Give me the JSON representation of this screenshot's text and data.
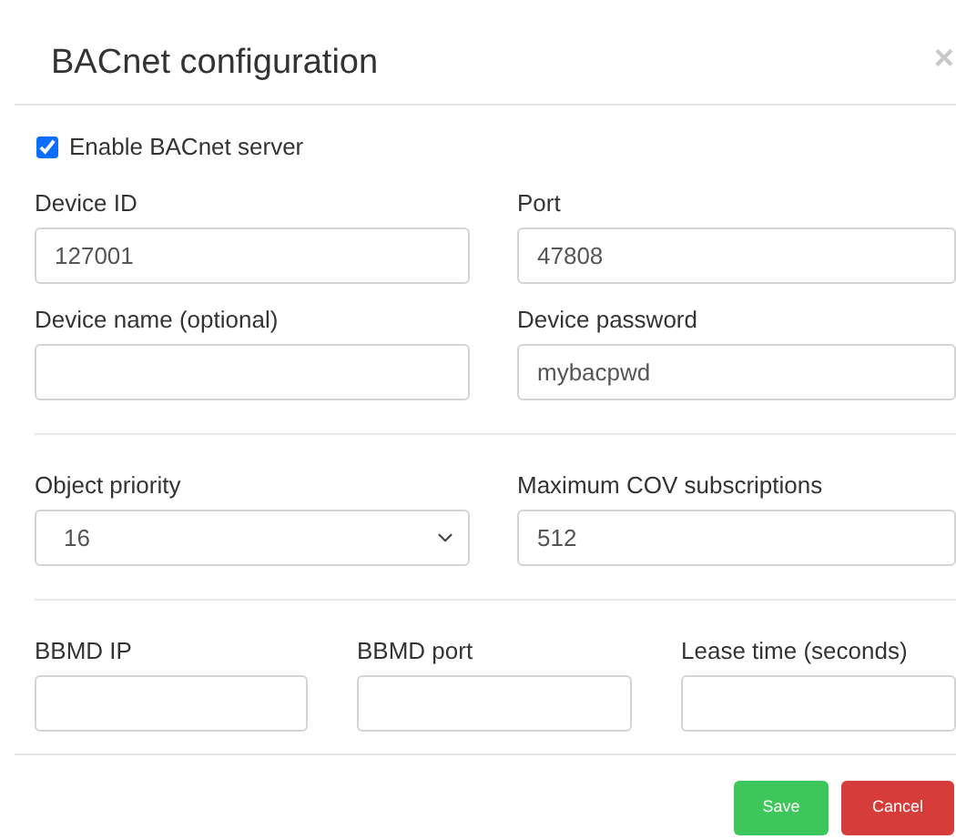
{
  "dialog": {
    "title": "BACnet configuration",
    "close": "×"
  },
  "enable": {
    "label": "Enable BACnet server",
    "checked": true
  },
  "sections": [
    {
      "fields": [
        {
          "kind": "input",
          "label": "Device ID",
          "value": "127001"
        },
        {
          "kind": "input",
          "label": "Port",
          "value": "47808"
        },
        {
          "kind": "input",
          "label": "Device name (optional)"
        },
        {
          "kind": "input",
          "label": "Device password",
          "value": "mybacpwd"
        }
      ]
    },
    {
      "fields": [
        {
          "kind": "select",
          "label": "Object priority",
          "value": "16"
        },
        {
          "kind": "input",
          "label": "Maximum COV subscriptions",
          "value": "512"
        }
      ]
    },
    {
      "fields": [
        {
          "kind": "input",
          "label": "BBMD IP"
        },
        {
          "kind": "input",
          "label": "BBMD port"
        },
        {
          "kind": "input",
          "label": "Lease time (seconds)"
        }
      ]
    }
  ],
  "buttons": [
    {
      "kind": "save",
      "label": "Save"
    },
    {
      "kind": "cancel",
      "label": "Cancel"
    }
  ]
}
